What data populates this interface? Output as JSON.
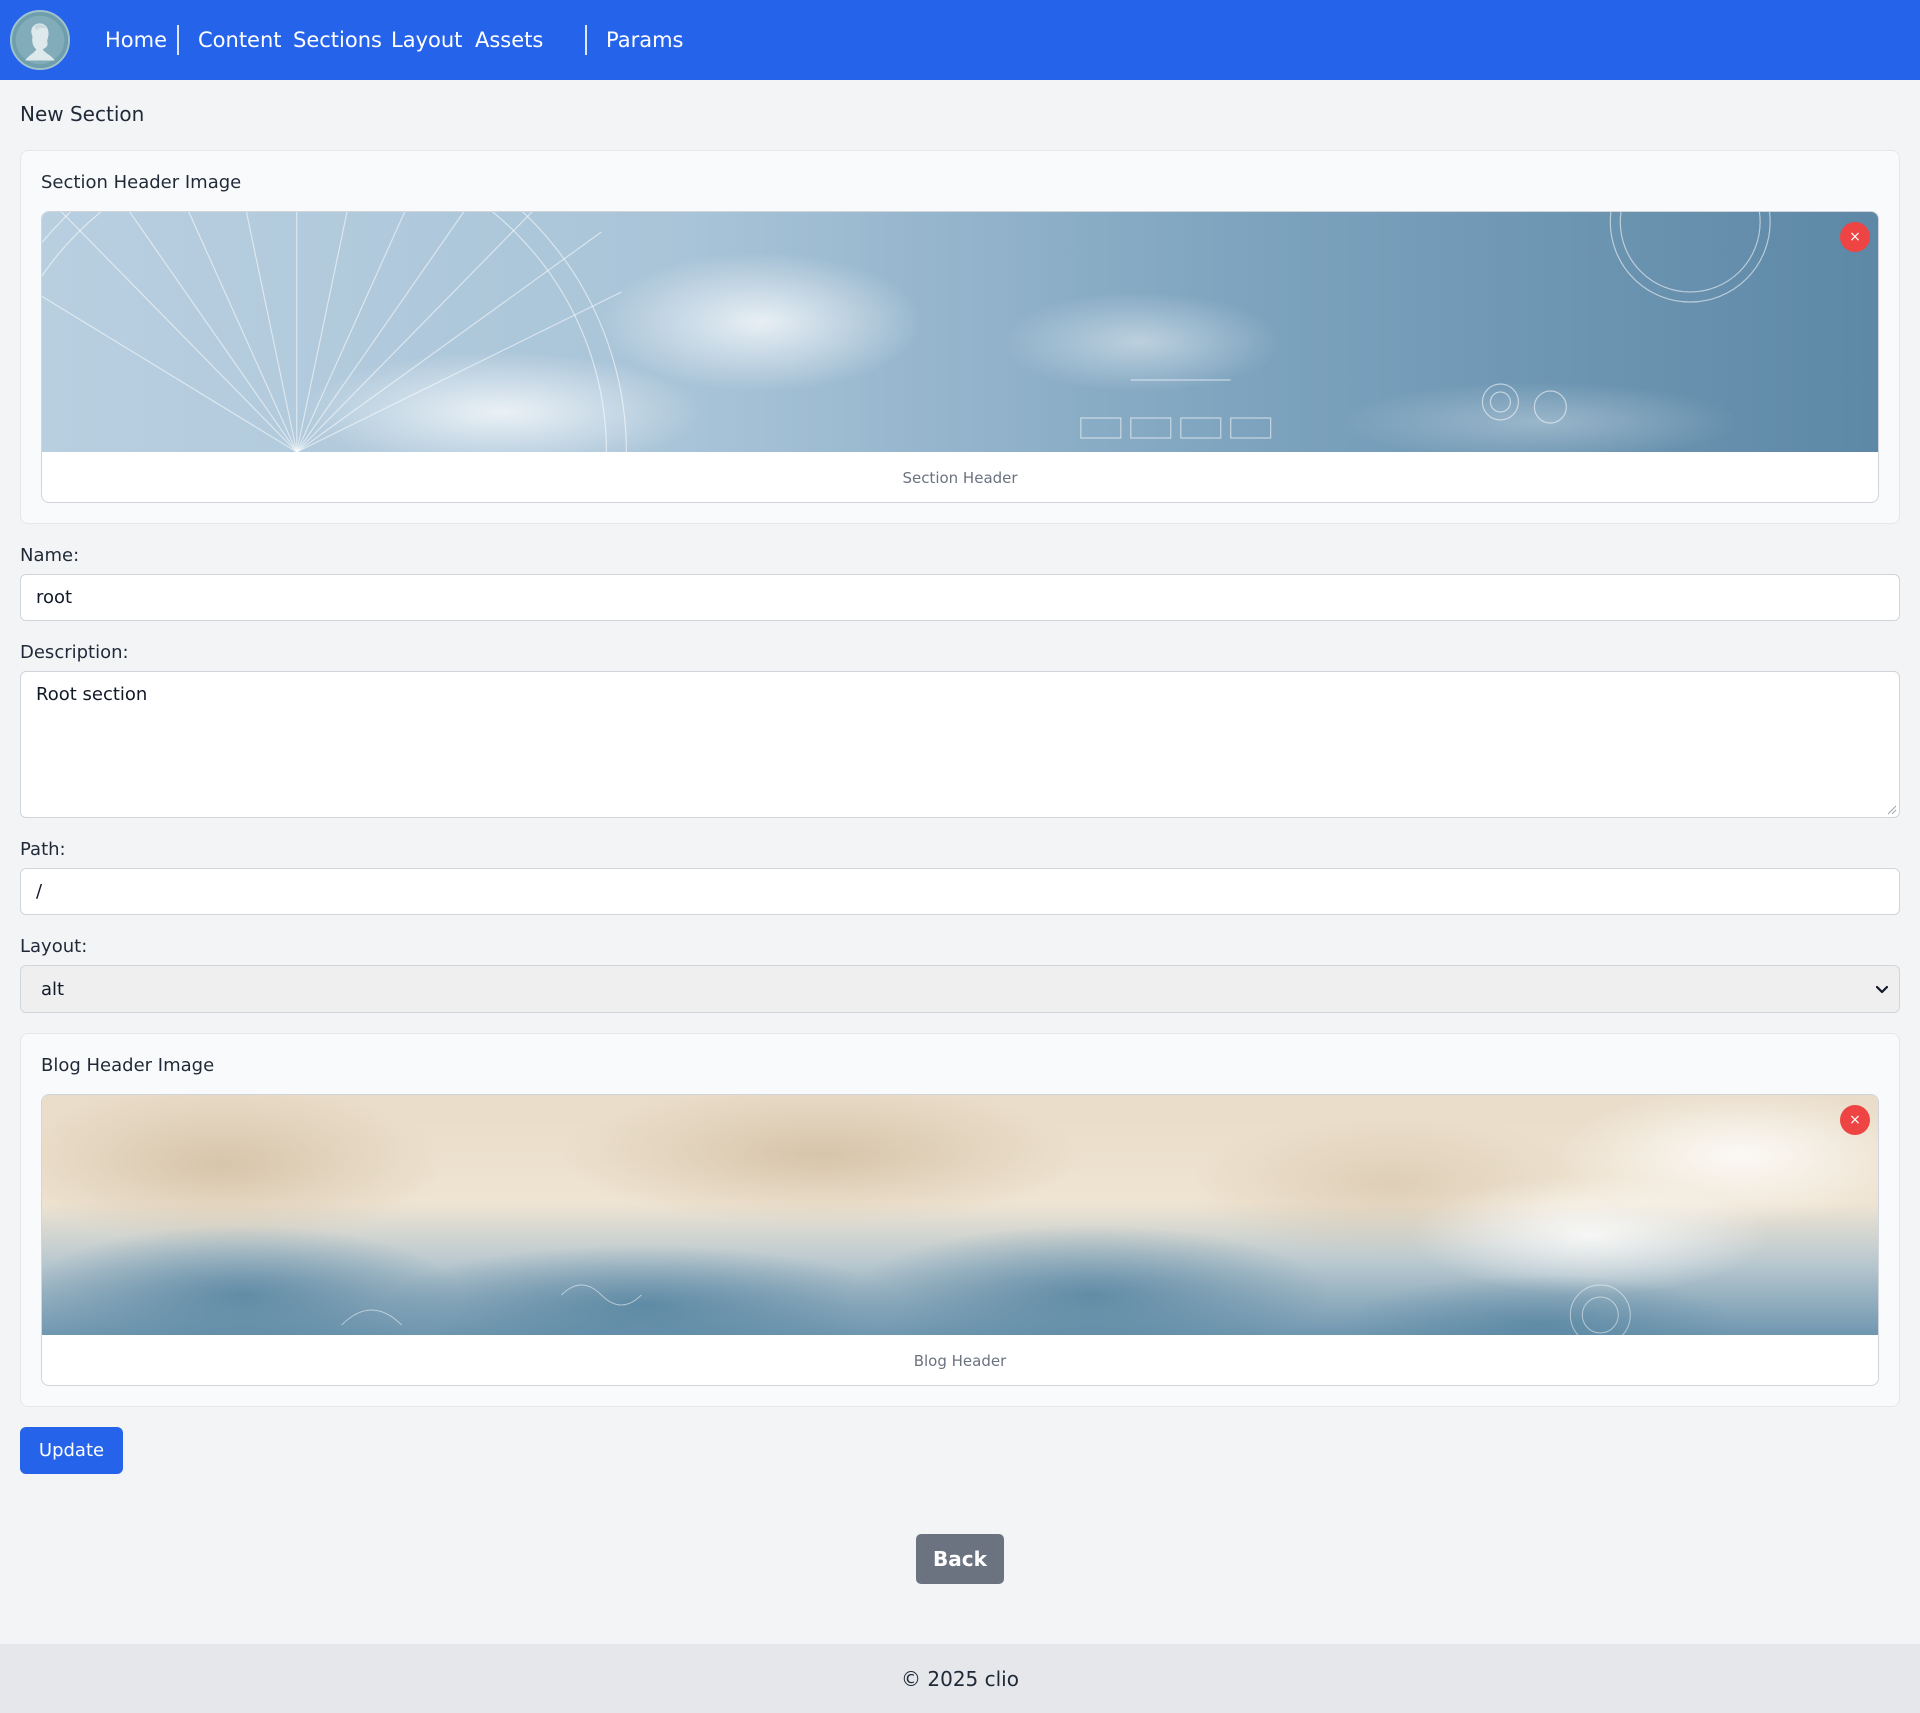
{
  "nav": {
    "logo_icon": "bust-logo-icon",
    "items": [
      {
        "label": "Home"
      },
      {
        "label": "Content"
      },
      {
        "label": "Sections"
      },
      {
        "label": "Layout"
      },
      {
        "label": "Assets"
      },
      {
        "label": "Params"
      }
    ],
    "background": "#2563eb"
  },
  "page": {
    "title": "New Section"
  },
  "section_header": {
    "title": "Section Header Image",
    "caption": "Section Header",
    "remove_label": "×"
  },
  "form": {
    "name_label": "Name:",
    "name_value": "root",
    "description_label": "Description:",
    "description_value": "Root section",
    "path_label": "Path:",
    "path_value": "/",
    "layout_label": "Layout:",
    "layout_value": "alt"
  },
  "blog_header": {
    "title": "Blog Header Image",
    "caption": "Blog Header",
    "remove_label": "×"
  },
  "actions": {
    "update_label": "Update",
    "back_label": "Back"
  },
  "footer": {
    "text": "© 2025 clio"
  },
  "colors": {
    "primary": "#2563eb",
    "danger": "#ef4444",
    "secondary": "#6b7280"
  }
}
